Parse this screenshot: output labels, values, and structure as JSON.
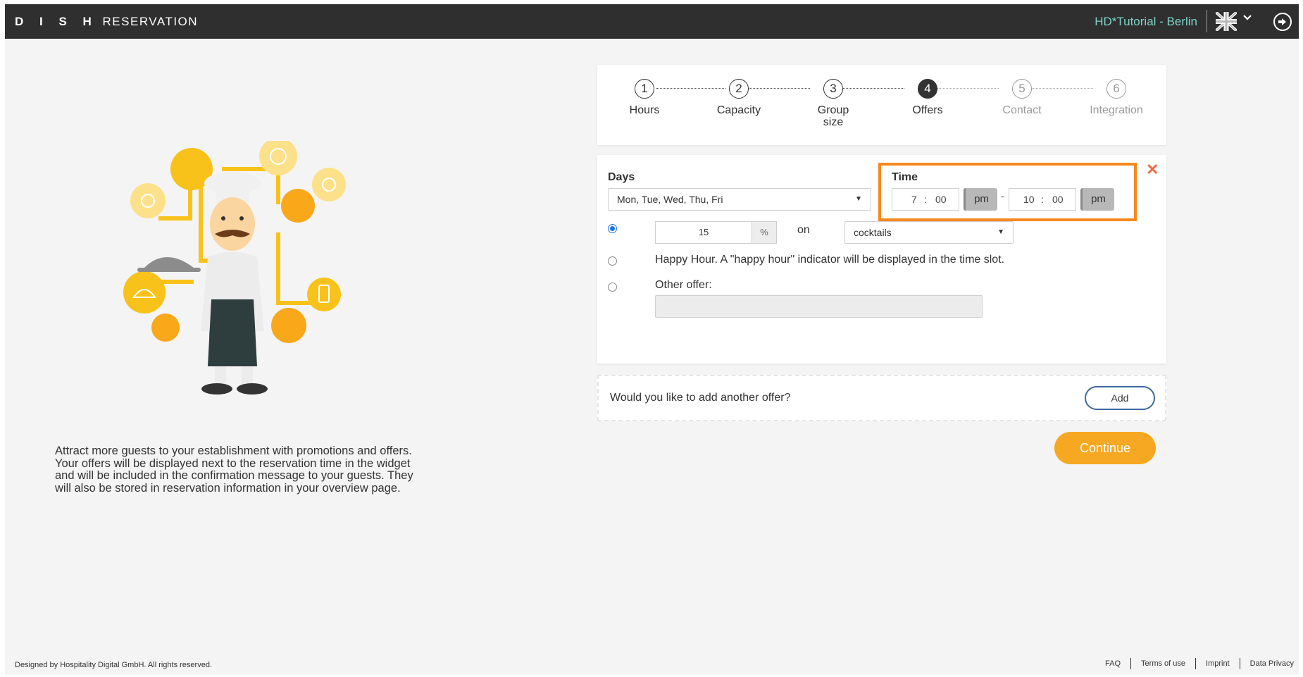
{
  "header": {
    "brand_bold": "D I S H",
    "brand_rest": "RESERVATION",
    "account": "HD*Tutorial - Berlin",
    "language_icon": "uk-flag-icon",
    "logout_icon": "logout-icon"
  },
  "intro_text": "Attract more guests to your establishment with promotions and offers. Your offers will be displayed next to the reservation time in the widget and will be included in the confirmation message to your guests. They will also be stored in reservation information in your overview page.",
  "steps": [
    {
      "num": "1",
      "label": "Hours"
    },
    {
      "num": "2",
      "label": "Capacity"
    },
    {
      "num": "3",
      "label": "Group size"
    },
    {
      "num": "4",
      "label": "Offers"
    },
    {
      "num": "5",
      "label": "Contact"
    },
    {
      "num": "6",
      "label": "Integration"
    }
  ],
  "offer": {
    "days_label": "Days",
    "days_value": "Mon, Tue, Wed, Thu, Fri",
    "time_label": "Time",
    "start_hour": "7",
    "start_min": "00",
    "start_ampm": "pm",
    "time_dash": "-",
    "end_hour": "10",
    "end_min": "00",
    "end_ampm": "pm",
    "time_sep": ":",
    "discount_value": "15",
    "discount_unit": "%",
    "on_label": "on",
    "category_value": "cocktails",
    "happy_hour_text": "Happy Hour. A \"happy hour\" indicator will be displayed in the time slot.",
    "other_offer_label": "Other offer:",
    "other_offer_value": "",
    "close_symbol": "✕"
  },
  "add_offer": {
    "question": "Would you like to add another offer?",
    "button": "Add"
  },
  "continue_label": "Continue",
  "footer": {
    "copyright": "Designed by Hospitality Digital GmbH. All rights reserved.",
    "links": [
      "FAQ",
      "Terms of use",
      "Imprint",
      "Data Privacy"
    ]
  },
  "colors": {
    "topbar": "#2f2f2f",
    "account": "#7ed3c8",
    "highlight": "#f5891f",
    "continue": "#f7a823",
    "close": "#f06a3f"
  }
}
